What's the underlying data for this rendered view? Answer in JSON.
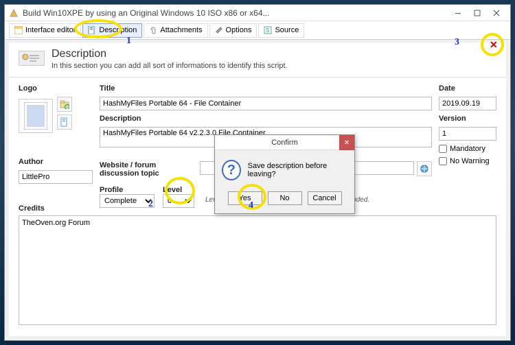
{
  "titlebar": {
    "title": "Build Win10XPE by using an Original Windows 10 ISO x86 or x64..."
  },
  "toolbar": {
    "interface_editor": "Interface editor",
    "description": "Description",
    "attachments": "Attachments",
    "options": "Options",
    "source": "Source"
  },
  "closeX": "✕",
  "header": {
    "title": "Description",
    "subtitle": "In this section you can add all sort of informations to identify this script."
  },
  "form": {
    "logo_label": "Logo",
    "title_label": "Title",
    "title_value": "HashMyFiles Portable 64 - File Container",
    "description_label": "Description",
    "description_value": "HashMyFiles Portable 64 v2.2.3.0 File Container",
    "date_label": "Date",
    "date_value": "2019.09.19",
    "version_label": "Version",
    "version_value": "1",
    "mandatory_label": "Mandatory",
    "nowarning_label": "No Warning",
    "author_label": "Author",
    "author_value": "LittlePro",
    "website_label": "Website / forum discussion topic",
    "profile_label": "Profile",
    "profile_value": "Complete",
    "level_label": "Level",
    "level_value": "0",
    "level_hint": "Level: ______________ is group level has concluded.",
    "credits_label": "Credits",
    "credits_value": "TheOven.org Forum"
  },
  "dialog": {
    "title": "Confirm",
    "message": "Save description before leaving?",
    "yes": "Yes",
    "no": "No",
    "cancel": "Cancel"
  },
  "annotations": {
    "n1": "1",
    "n2": "2",
    "n3": "3",
    "n4": "4"
  }
}
